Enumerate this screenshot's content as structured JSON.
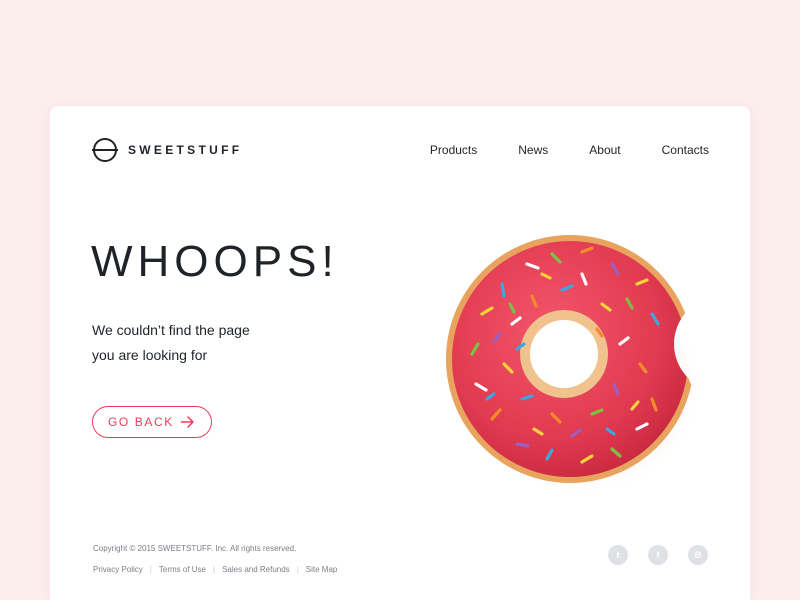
{
  "brand": {
    "name": "SWEETSTUFF"
  },
  "nav": {
    "items": [
      {
        "label": "Products"
      },
      {
        "label": "News"
      },
      {
        "label": "About"
      },
      {
        "label": "Contacts"
      }
    ]
  },
  "hero": {
    "headline": "WHOOPS!",
    "message_line1": "We couldn’t find the page",
    "message_line2": "you are looking for",
    "back_button_label": "GO BACK"
  },
  "footer": {
    "copyright": "Copyright © 2015 SWEETSTUFF. Inc. All rights reserved.",
    "links": [
      {
        "label": "Privacy Policy"
      },
      {
        "label": "Terms of Use"
      },
      {
        "label": "Sales and Refunds"
      },
      {
        "label": "Site Map"
      }
    ],
    "social": [
      {
        "glyph": "t",
        "icon": "twitter-icon"
      },
      {
        "glyph": "f",
        "icon": "facebook-icon"
      },
      {
        "glyph": "B",
        "icon": "behance-icon"
      }
    ]
  },
  "colors": {
    "page_background": "#fdeeee",
    "card_background": "#ffffff",
    "accent": "#ec3b5d",
    "text": "#1f2328",
    "muted_text": "#7a7e85",
    "social_icon_bg": "#dfe1e4"
  }
}
